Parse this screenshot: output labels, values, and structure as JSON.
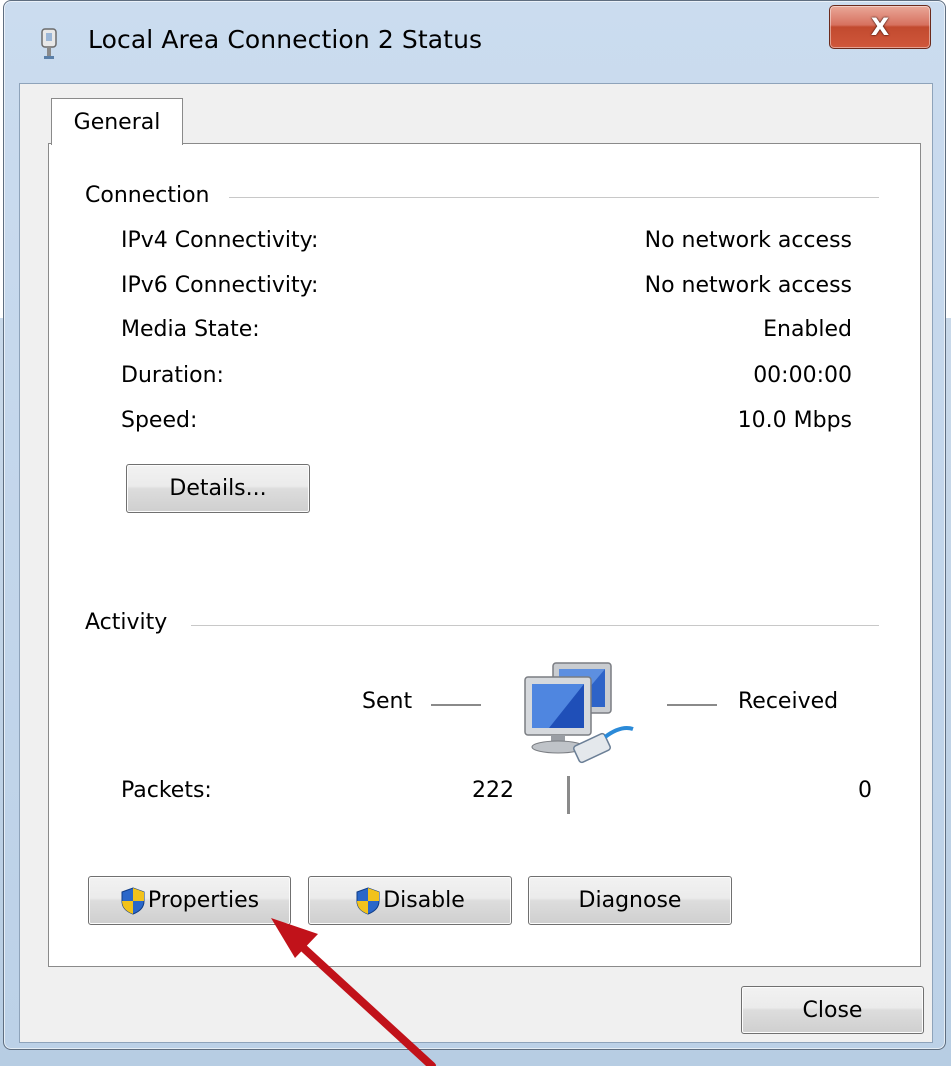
{
  "window": {
    "title": "Local Area Connection 2 Status",
    "close_glyph": "X"
  },
  "tabs": [
    {
      "label": "General",
      "selected": true
    }
  ],
  "connection": {
    "group_label": "Connection",
    "rows": [
      {
        "label": "IPv4 Connectivity:",
        "value": "No network access"
      },
      {
        "label": "IPv6 Connectivity:",
        "value": "No network access"
      },
      {
        "label": "Media State:",
        "value": "Enabled"
      },
      {
        "label": "Duration:",
        "value": "00:00:00"
      },
      {
        "label": "Speed:",
        "value": "10.0 Mbps"
      }
    ],
    "details_button": "Details..."
  },
  "activity": {
    "group_label": "Activity",
    "sent_label": "Sent",
    "received_label": "Received",
    "packets_label": "Packets:",
    "packets_sent": "222",
    "packets_received": "0"
  },
  "buttons": {
    "properties": "Properties",
    "disable": "Disable",
    "diagnose": "Diagnose",
    "close": "Close"
  },
  "icons": {
    "title": "network-adapter-icon",
    "activity": "network-computers-icon",
    "shield": "uac-shield-icon"
  },
  "colors": {
    "title_bar": "#c3d6eb",
    "close_button": "#c24a2f",
    "arrow": "#c1121a"
  }
}
